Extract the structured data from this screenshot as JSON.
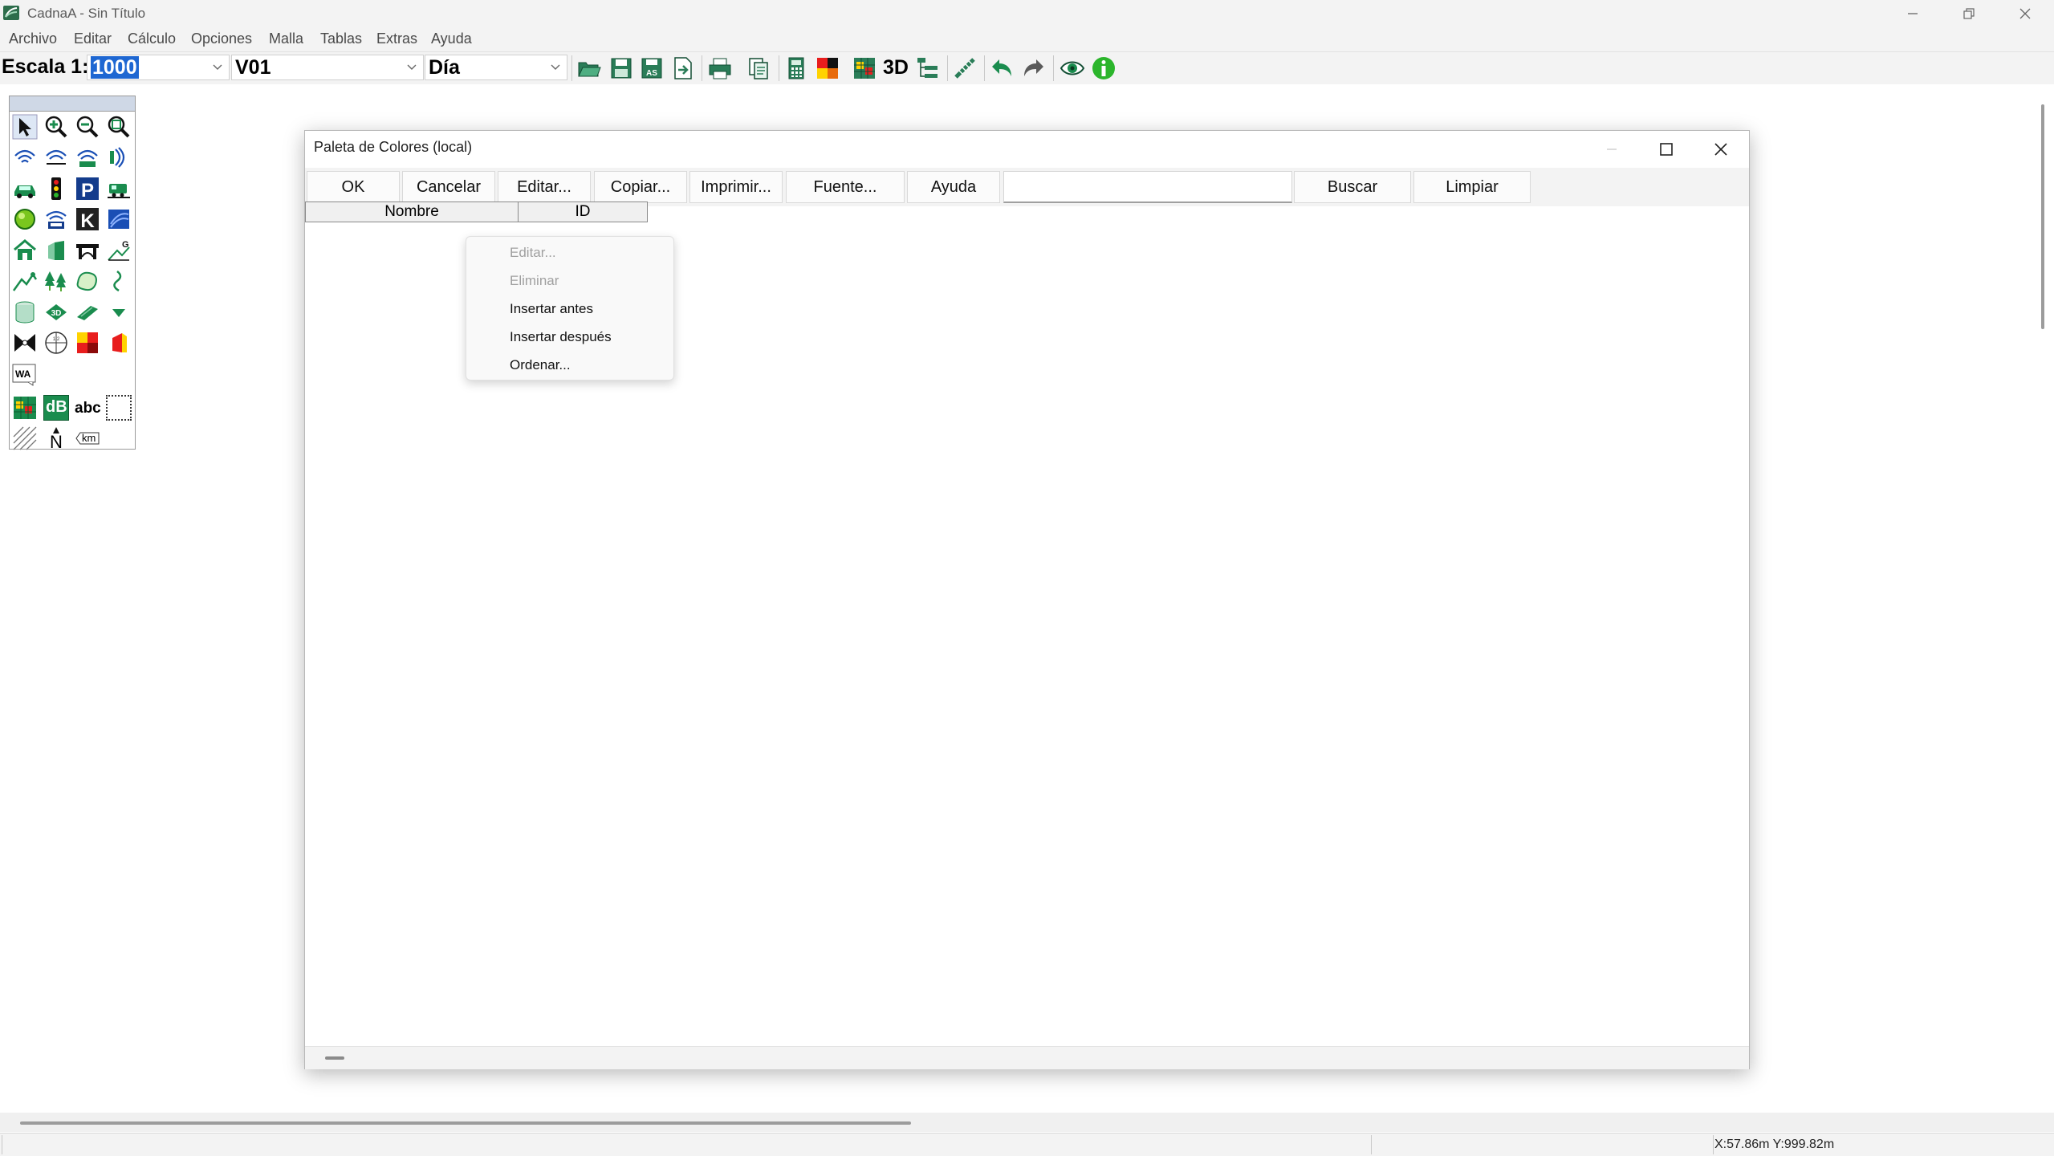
{
  "window": {
    "title": "CadnaA - Sin Título",
    "icon": "cadna-app-icon",
    "controls": [
      "minimize-icon",
      "restore-icon",
      "close-icon"
    ]
  },
  "menubar": {
    "items": [
      "Archivo",
      "Editar",
      "Cálculo",
      "Opciones",
      "Malla",
      "Tablas",
      "Extras",
      "Ayuda"
    ]
  },
  "toolbar": {
    "scale_label": "Escala 1:",
    "scale_value": "1000",
    "variant_value": "V01",
    "period_value": "Día",
    "label_3d": "3D",
    "icons": [
      "open-folder-icon",
      "save-icon",
      "save-as-icon",
      "export-icon",
      "print-icon",
      "copy-page-icon",
      "calculator-icon",
      "color-palette-icon",
      "grid-map-icon",
      "3d-icon",
      "object-tree-icon",
      "measure-icon",
      "undo-icon",
      "redo-icon",
      "view-eye-icon",
      "info-icon"
    ]
  },
  "palette": {
    "tools": [
      [
        "select-arrow-icon",
        "zoom-in-icon",
        "zoom-out-icon",
        "zoom-window-icon"
      ],
      [
        "point-source-icon",
        "line-source-icon",
        "area-source-icon",
        "vertical-area-source-icon"
      ],
      [
        "road-icon",
        "traffic-light-icon",
        "parking-lot-icon",
        "railway-icon"
      ],
      [
        "receiver-point-icon",
        "industry-source-icon",
        "k-object-icon",
        "noise-barrier-icon"
      ],
      [
        "building-icon",
        "facade-icon",
        "bridge-icon",
        "ground-absorption-icon"
      ],
      [
        "terrain-icon",
        "forest-icon",
        "contour-area-icon",
        "embankment-icon"
      ],
      [
        "cylinder-icon",
        "3d-reflector-icon",
        "height-line-icon",
        "height-point-icon"
      ],
      [
        "gear-cross-icon",
        "calc-area-icon",
        "color-grid-icon",
        "section-icon"
      ],
      [
        "wind-arrow-icon"
      ],
      [
        "grid-object-icon",
        "db-label-icon",
        "text-abc-icon",
        "selection-rect-icon"
      ],
      [
        "hatch-icon",
        "north-arrow-icon",
        "km-scale-icon"
      ]
    ],
    "wa_label": "WA",
    "db_label": "dB",
    "abc_label": "abc",
    "km_label": "km",
    "n_label": "N"
  },
  "dialog": {
    "title": "Paleta de Colores (local)",
    "buttons": {
      "ok": "OK",
      "cancel": "Cancelar",
      "edit": "Editar...",
      "copy": "Copiar...",
      "print": "Imprimir...",
      "font": "Fuente...",
      "help": "Ayuda",
      "search": "Buscar",
      "clear": "Limpiar"
    },
    "search_value": "",
    "columns": [
      "Nombre",
      "ID"
    ],
    "rows": []
  },
  "context_menu": {
    "items": [
      {
        "label": "Editar...",
        "enabled": false
      },
      {
        "label": "Eliminar",
        "enabled": false
      },
      {
        "label": "Insertar antes",
        "enabled": true
      },
      {
        "label": "Insertar después",
        "enabled": true
      },
      {
        "label": "Ordenar...",
        "enabled": true
      }
    ]
  },
  "status": {
    "coordinates": "X:57.86m Y:999.82m"
  },
  "colors": {
    "accent_green": "#1a8c4e",
    "selection_blue": "#1e67d2",
    "info_green": "#2bb52b"
  }
}
